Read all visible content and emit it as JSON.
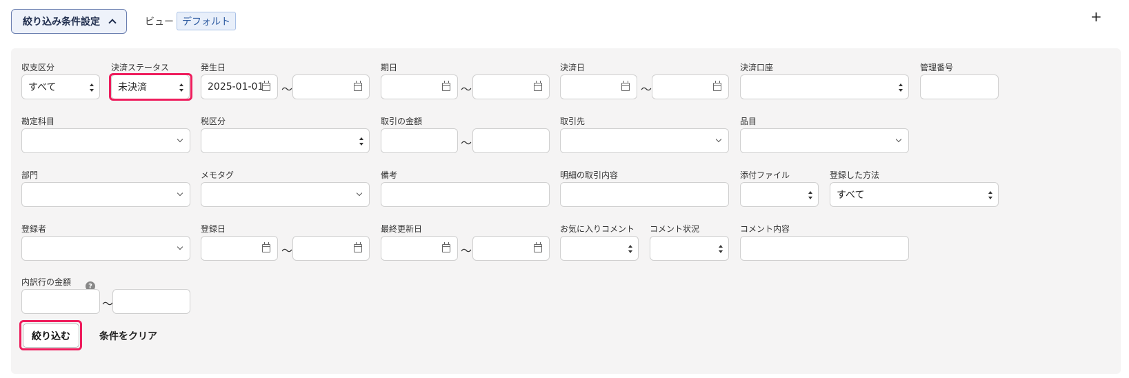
{
  "header": {
    "toggle_label": "絞り込み条件設定",
    "view_label": "ビュー",
    "view_value": "デフォルト",
    "add_label": "+"
  },
  "tilde": "〜",
  "filters": {
    "income_type": {
      "label": "収支区分",
      "value": "すべて"
    },
    "settlement_status": {
      "label": "決済ステータス",
      "value": "未決済"
    },
    "issue_date": {
      "label": "発生日",
      "from": "2025-01-01",
      "to": ""
    },
    "due_date": {
      "label": "期日",
      "from": "",
      "to": ""
    },
    "settlement_date": {
      "label": "決済日",
      "from": "",
      "to": ""
    },
    "settlement_account": {
      "label": "決済口座",
      "value": ""
    },
    "management_number": {
      "label": "管理番号",
      "value": ""
    },
    "account_item": {
      "label": "勘定科目",
      "value": ""
    },
    "tax_category": {
      "label": "税区分",
      "value": ""
    },
    "transaction_amount": {
      "label": "取引の金額",
      "from": "",
      "to": ""
    },
    "partner": {
      "label": "取引先",
      "value": ""
    },
    "item": {
      "label": "品目",
      "value": ""
    },
    "department": {
      "label": "部門",
      "value": ""
    },
    "memo_tag": {
      "label": "メモタグ",
      "value": ""
    },
    "remarks": {
      "label": "備考",
      "value": ""
    },
    "detail_content": {
      "label": "明細の取引内容",
      "value": ""
    },
    "attachment": {
      "label": "添付ファイル",
      "value": ""
    },
    "registration_method": {
      "label": "登録した方法",
      "value": "すべて"
    },
    "registrant": {
      "label": "登録者",
      "value": ""
    },
    "registration_date": {
      "label": "登録日",
      "from": "",
      "to": ""
    },
    "last_updated": {
      "label": "最終更新日",
      "from": "",
      "to": ""
    },
    "favorite_comment": {
      "label": "お気に入りコメント",
      "value": ""
    },
    "comment_status": {
      "label": "コメント状況",
      "value": ""
    },
    "comment_content": {
      "label": "コメント内容",
      "value": ""
    },
    "breakdown_amount": {
      "label": "内訳行の金額",
      "from": "",
      "to": ""
    }
  },
  "actions": {
    "apply_label": "絞り込む",
    "clear_label": "条件をクリア"
  },
  "colors": {
    "highlight": "#ee1c5c",
    "panel_bg": "#f5f4f4",
    "toggle_border": "#6b7fb0"
  }
}
